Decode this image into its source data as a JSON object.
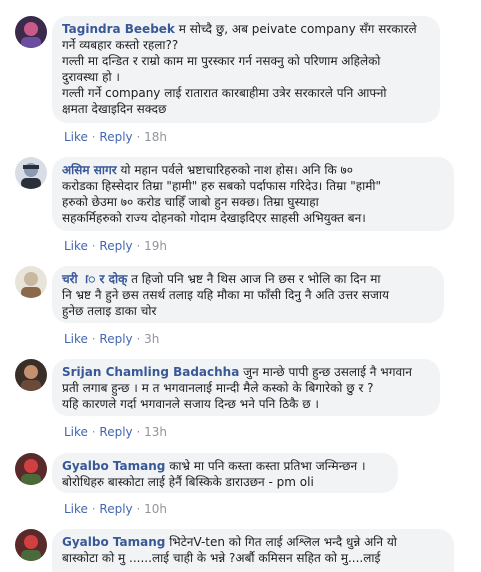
{
  "actions": {
    "like": "Like",
    "reply": "Reply",
    "sep": " · "
  },
  "comments": [
    {
      "author": "Tagindra Beebek",
      "lines": [
        " म सोच्दै छु, अब peivate company सँग सरकारले",
        "गर्ने व्यबहार कस्तो रहला??",
        "गल्ती मा दन्डित र राम्रो काम मा पुरस्कार गर्न नसक्नु को परिणाम अहिलेको",
        "दुरावस्था हो ।",
        "गल्ती गर्ने company लाई रातारात कारबाहीमा उत्रेर सरकारले पनि आफ्नो",
        "क्षमता देखाइदिन सक्दछ"
      ],
      "time": "18h",
      "avatar_colors": [
        "#3b2a4a",
        "#c85a8a",
        "#6a4fa0"
      ]
    },
    {
      "author": "असिम सागर",
      "lines": [
        " यो महान पर्वले भ्रष्टाचारिहरुको नाश होस। अनि कि ७०",
        "करोडका हिस्सेदार तिम्रा \"हामी\" हरु सबको पर्दाफास गरिदेउ। तिम्रा \"हामी\"",
        "हरुको छेउमा ७० करोड चाहिँ जाबो हुन सक्छ। तिम्रा घुस्याहा",
        "सहकर्मिहरुको राज्य दोहनको गोदाम देखाइदिएर साहसी अभियुक्त बन।"
      ],
      "time": "19h",
      "avatar_colors": [
        "#d8dde6",
        "#2a2f3a",
        "#8a9ab0"
      ]
    },
    {
      "author": "चरी ‍ ॎ र दोक्",
      "lines": [
        " त हिजो पनि भ्रष्ट नै थिस आज नि छस र भोलि का दिन मा",
        "नि भ्रष्ट नै हुने छस तसर्थ तलाइ यहि मौका मा फाँसी दिनु नै अति उत्तर सजाय",
        "हुनेछ तलाइ डाका चोर"
      ],
      "time": "3h",
      "avatar_colors": [
        "#e9e4da",
        "#8a6a4a",
        "#c9b8a0"
      ]
    },
    {
      "author": "Srijan Chamling Badachha",
      "lines": [
        " जुन मान्छे पापी हुन्छ उसलाई नै भगवान",
        "प्रती लगाब हुन्छ । म त भगवानलाई मान्दी मैले कस्को के बिगारेको छु र ?",
        "यहि कारणले गर्दा भगवानले सजाय दिन्छ भने पनि ठिकै छ ।"
      ],
      "time": "13h",
      "avatar_colors": [
        "#3a2f28",
        "#c49070",
        "#6b4a3a"
      ]
    },
    {
      "author": "Gyalbo Tamang",
      "lines": [
        " काभ्रे मा पनि कस्ता कस्ता प्रतिभा जन्मिन्छन ।",
        "बोरोधिहरु बास्कोटा लाई हेर्नै बिस्किके डाराउछन - pm oli"
      ],
      "time": "10h",
      "avatar_colors": [
        "#5a2a2a",
        "#d04040",
        "#4a6a3a"
      ]
    },
    {
      "author": "Gyalbo Tamang",
      "lines": [
        " भिटेनV-ten को गित लाई अश्लिल भन्दै धुन्ने अनि यो",
        "बास्कोटा को मु ......लाई चाही के भन्ने ?अर्बौ कमिसन सहित को मु....लाई"
      ],
      "time": "",
      "avatar_colors": [
        "#5a2a2a",
        "#d04040",
        "#4a6a3a"
      ]
    }
  ]
}
